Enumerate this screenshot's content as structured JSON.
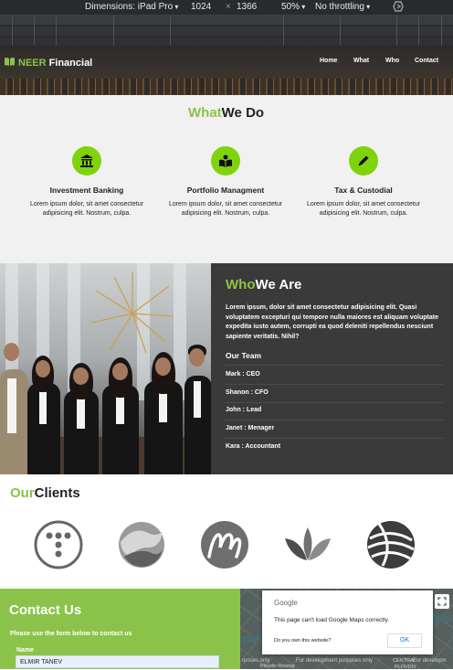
{
  "devtools": {
    "dimensions_label": "Dimensions: iPad Pro",
    "width": "1024",
    "times": "×",
    "height": "1366",
    "zoom": "50%",
    "throttle": "No throttling",
    "rotate_icon": "rotate-icon"
  },
  "nav": {
    "brand_prefix": "NEER",
    "brand_suffix": "Financial",
    "brand_icon": "book-icon",
    "links": [
      "Home",
      "What",
      "Who",
      "Contact"
    ]
  },
  "what": {
    "title_accent": "What",
    "title_rest": "We Do",
    "services": [
      {
        "icon": "bank-icon",
        "title": "Investment Banking",
        "desc": "Lorem ipsum dolor, sit amet consectetur adipisicing elit. Nostrum, culpa."
      },
      {
        "icon": "book-open-icon",
        "title": "Portfolio Managment",
        "desc": "Lorem ipsum dolor, sit amet consectetur adipisicing elit. Nostrum, culpa."
      },
      {
        "icon": "pencil-icon",
        "title": "Tax & Custodial",
        "desc": "Lorem ipsum dolor, sit amet consectetur adipisicing elit. Nostrum, culpa."
      }
    ]
  },
  "who": {
    "title_accent": "Who",
    "title_rest": "We Are",
    "paragraph": "Lorem ipsum, dolor sit amet consectetur adipisicing elit. Quasi voluptatem excepturi qui tempore nulla maiores est aliquam voluptate expedita iusto autem, corrupti ea quod deleniti repellendus nesciunt sapiente veritatis. Nihil?",
    "team_heading": "Our Team",
    "team": [
      "Mark : CEO",
      "Shanon : CFO",
      "John : Lead",
      "Janet : Menager",
      "Kara : Accountant"
    ]
  },
  "clients": {
    "title_accent": "Our",
    "title_rest": "Clients",
    "logos": [
      "client-logo-t-icon",
      "client-logo-wave-icon",
      "client-logo-m-icon",
      "client-logo-leaf-icon",
      "client-logo-globe-icon"
    ]
  },
  "contact": {
    "title": "Contact Us",
    "subtitle": "Please use the form below to contact us",
    "name_label": "Name",
    "name_value": "ELMIR TANEV"
  },
  "map": {
    "provider": "Google",
    "message": "This page can't load Google Maps correctly.",
    "own_question": "Do you own this website?",
    "ok_label": "OK",
    "dev_note_1": "rposes only",
    "dev_note_2": "For development purposes only",
    "dev_note_3": "For developm",
    "place_1": "Plovdiv Rowing",
    "place_2": "CENTRAL",
    "place_3": "PLOVDIV"
  },
  "colors": {
    "accent": "#8bc34a",
    "icon_circle": "#7fd30b",
    "dark": "#3a3a3a",
    "devtools": "#292a2d"
  }
}
